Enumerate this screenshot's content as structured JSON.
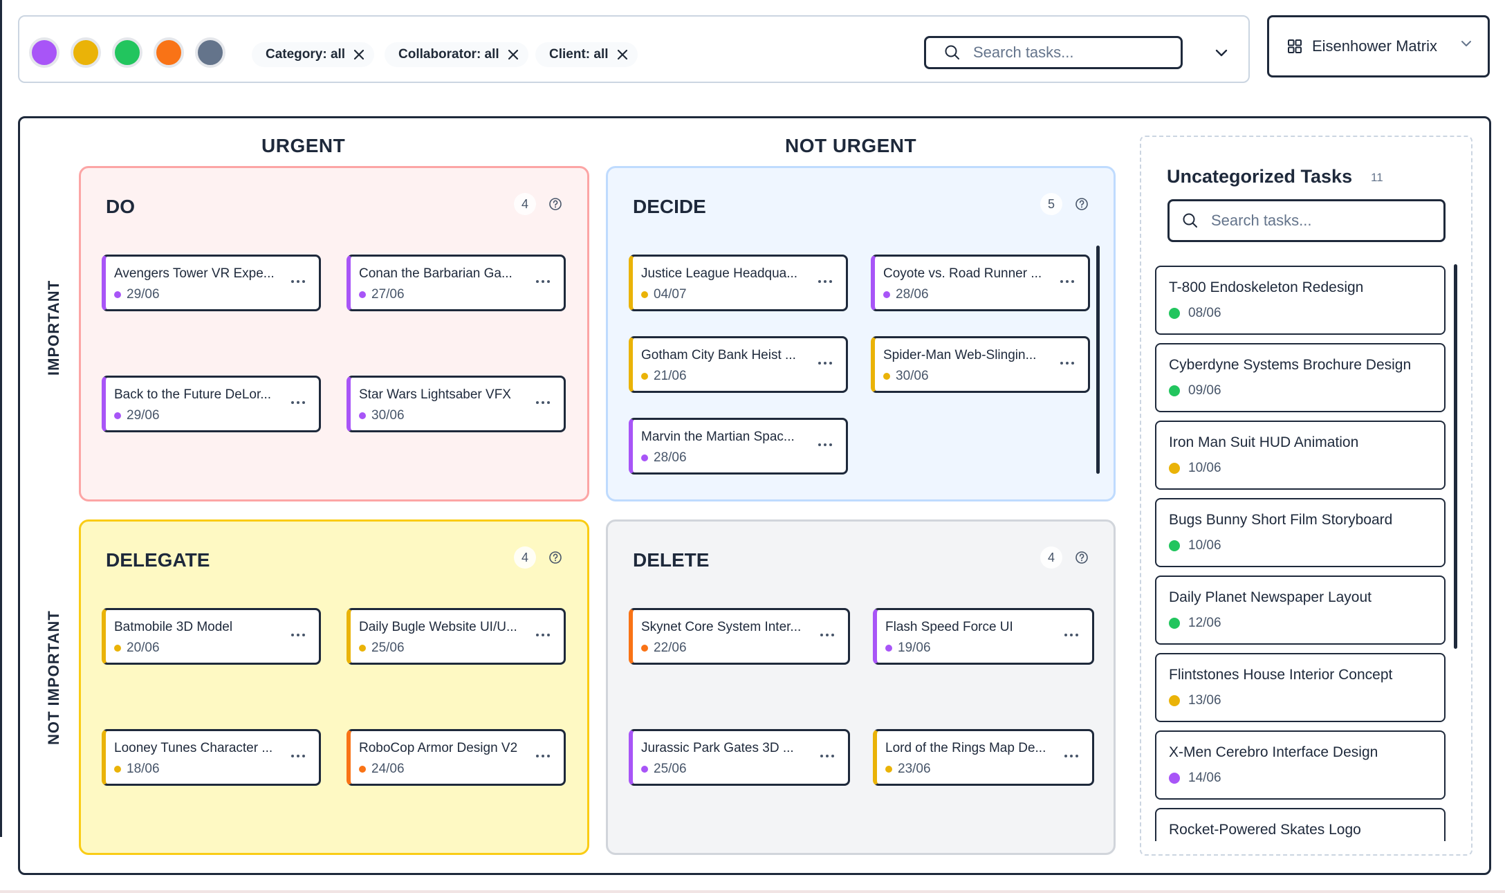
{
  "filters": {
    "colors": [
      "#a855f7",
      "#eab308",
      "#22c55e",
      "#f97316",
      "#64748b"
    ],
    "chips": [
      {
        "label": "Category: all"
      },
      {
        "label": "Collaborator: all"
      },
      {
        "label": "Client: all"
      }
    ],
    "search_placeholder": "Search tasks..."
  },
  "view_selector": {
    "label": "Eisenhower Matrix"
  },
  "matrix": {
    "col_urgent": "URGENT",
    "col_not_urgent": "NOT URGENT",
    "row_important": "IMPORTANT",
    "row_not_important": "NOT IMPORTANT",
    "quadrants": {
      "do": {
        "title": "DO",
        "count": "4",
        "tasks": [
          {
            "title": "Avengers Tower VR Expe...",
            "date": "29/06",
            "color": "#a855f7"
          },
          {
            "title": "Conan the Barbarian Ga...",
            "date": "27/06",
            "color": "#a855f7"
          },
          {
            "title": "Back to the Future DeLor...",
            "date": "29/06",
            "color": "#a855f7"
          },
          {
            "title": "Star Wars Lightsaber VFX",
            "date": "30/06",
            "color": "#a855f7"
          }
        ]
      },
      "decide": {
        "title": "DECIDE",
        "count": "5",
        "tasks": [
          {
            "title": "Justice League Headqua...",
            "date": "04/07",
            "color": "#eab308"
          },
          {
            "title": "Coyote vs. Road Runner ...",
            "date": "28/06",
            "color": "#a855f7"
          },
          {
            "title": "Gotham City Bank Heist ...",
            "date": "21/06",
            "color": "#eab308"
          },
          {
            "title": "Spider-Man Web-Slingin...",
            "date": "30/06",
            "color": "#eab308"
          },
          {
            "title": "Marvin the Martian Spac...",
            "date": "28/06",
            "color": "#a855f7"
          }
        ]
      },
      "delegate": {
        "title": "DELEGATE",
        "count": "4",
        "tasks": [
          {
            "title": "Batmobile 3D Model",
            "date": "20/06",
            "color": "#eab308"
          },
          {
            "title": "Daily Bugle Website UI/U...",
            "date": "25/06",
            "color": "#eab308"
          },
          {
            "title": "Looney Tunes Character ...",
            "date": "18/06",
            "color": "#eab308"
          },
          {
            "title": "RoboCop Armor Design V2",
            "date": "24/06",
            "color": "#f97316"
          }
        ]
      },
      "delete": {
        "title": "DELETE",
        "count": "4",
        "tasks": [
          {
            "title": "Skynet Core System Inter...",
            "date": "22/06",
            "color": "#f97316"
          },
          {
            "title": "Flash Speed Force UI",
            "date": "19/06",
            "color": "#a855f7"
          },
          {
            "title": "Jurassic Park Gates 3D ...",
            "date": "25/06",
            "color": "#a855f7"
          },
          {
            "title": "Lord of the Rings Map De...",
            "date": "23/06",
            "color": "#eab308"
          }
        ]
      }
    }
  },
  "uncategorized": {
    "title": "Uncategorized Tasks",
    "count": "11",
    "search_placeholder": "Search tasks...",
    "tasks": [
      {
        "title": "T-800 Endoskeleton Redesign",
        "date": "08/06",
        "color": "#22c55e"
      },
      {
        "title": "Cyberdyne Systems Brochure Design",
        "date": "09/06",
        "color": "#22c55e"
      },
      {
        "title": "Iron Man Suit HUD Animation",
        "date": "10/06",
        "color": "#eab308"
      },
      {
        "title": "Bugs Bunny Short Film Storyboard",
        "date": "10/06",
        "color": "#22c55e"
      },
      {
        "title": "Daily Planet Newspaper Layout",
        "date": "12/06",
        "color": "#22c55e"
      },
      {
        "title": "Flintstones House Interior Concept",
        "date": "13/06",
        "color": "#eab308"
      },
      {
        "title": "X-Men Cerebro Interface Design",
        "date": "14/06",
        "color": "#a855f7"
      },
      {
        "title": "Rocket-Powered Skates Logo",
        "date": "",
        "color": "#22c55e"
      }
    ]
  }
}
